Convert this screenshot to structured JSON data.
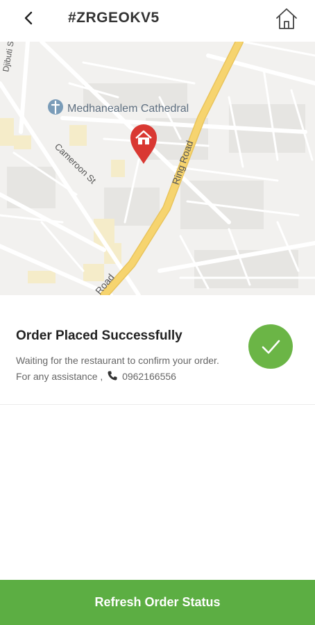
{
  "header": {
    "order_id": "#ZRGEOKV5"
  },
  "map": {
    "labels": {
      "cathedral": "Medhanealem Cathedral",
      "cameroon": "Cameroon St",
      "ring_road": "Ring Road",
      "ring_road_bottom": "Road",
      "djibuti": "Djibuti S"
    },
    "colors": {
      "major_road": "#f6d46f",
      "pin": "#d93832"
    }
  },
  "order_status": {
    "title": "Order Placed Successfully",
    "message": "Waiting for the restaurant to confirm your order. For any assistance ,",
    "phone": "0962166556",
    "status_color": "#6bb546"
  },
  "footer": {
    "refresh_label": "Refresh Order Status",
    "button_color": "#5cae43"
  }
}
